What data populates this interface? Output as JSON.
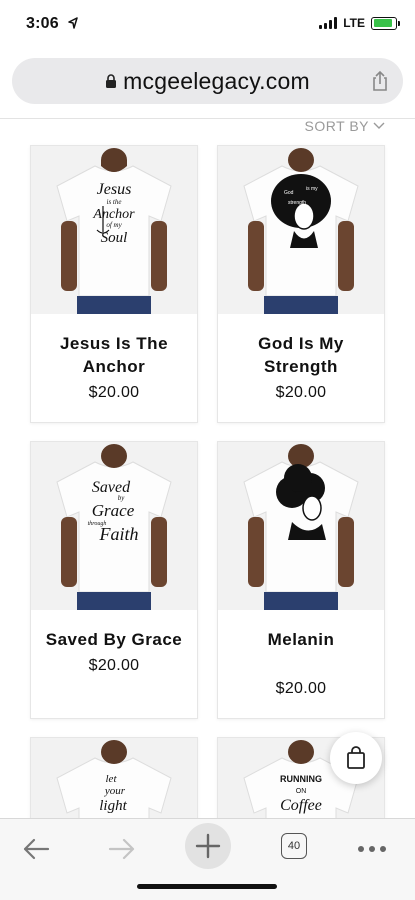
{
  "status": {
    "time": "3:06",
    "network": "LTE",
    "battery_level": 0.9,
    "battery_color": "#3ac24a"
  },
  "browser": {
    "url": "mcgeelegacy.com",
    "tab_count": "40"
  },
  "sort": {
    "label": "SORT BY"
  },
  "products": [
    {
      "title": "Jesus Is The Anchor",
      "price": "$20.00",
      "print": [
        "Jesus",
        "is the",
        "Anchor",
        "of my",
        "Soul"
      ]
    },
    {
      "title": "God Is My Strength",
      "price": "$20.00",
      "print": []
    },
    {
      "title": "Saved By Grace",
      "price": "$20.00",
      "print": [
        "Saved",
        "by",
        "Grace",
        "through",
        "Faith"
      ]
    },
    {
      "title": "Melanin",
      "price": "$20.00",
      "print": []
    },
    {
      "title": "",
      "price": "",
      "print": [
        "let",
        "your",
        "light"
      ]
    },
    {
      "title": "",
      "price": "",
      "print": [
        "RUNNING",
        "ON",
        "Coffee"
      ]
    }
  ],
  "icons": {
    "lock": "lock-icon",
    "share": "share-icon",
    "back": "back-arrow-icon",
    "forward": "forward-arrow-icon",
    "new_tab": "plus-icon",
    "tabs": "tabs-icon",
    "more": "more-icon",
    "cart": "shopping-bag-icon"
  }
}
